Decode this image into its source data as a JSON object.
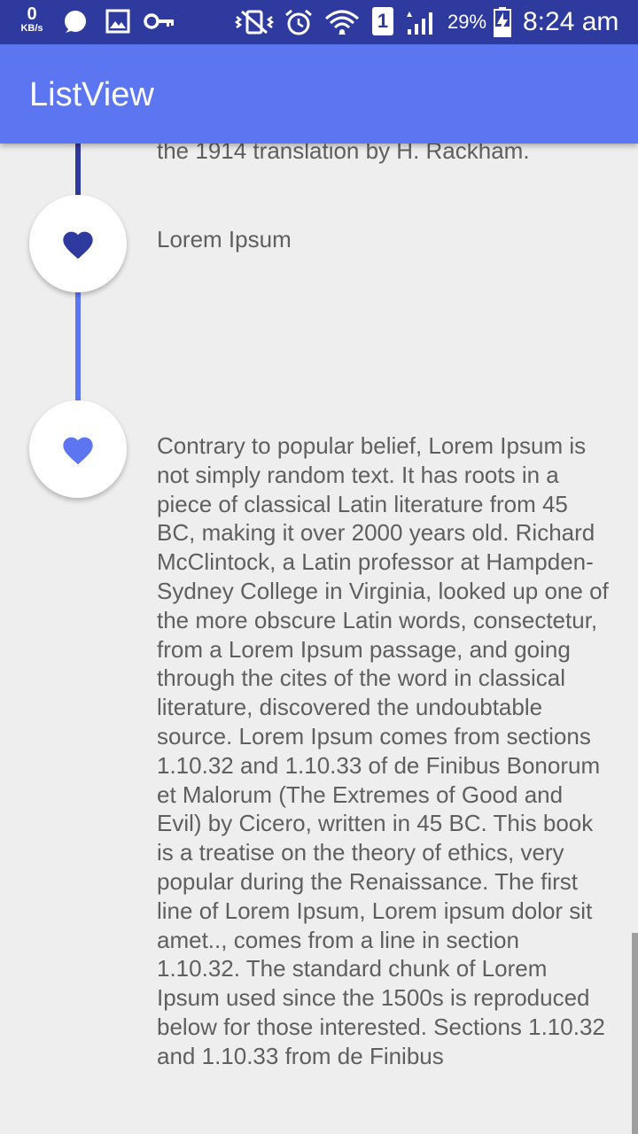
{
  "status_bar": {
    "kb_value": "0",
    "kb_unit": "KB/s",
    "sim_slot": "1",
    "battery_percent": "29%",
    "time": "8:24 am",
    "icons": [
      "chat-bubble-icon",
      "image-icon",
      "key-icon",
      "vibrate-icon",
      "alarm-icon",
      "wifi-icon",
      "sim-icon",
      "signal-icon",
      "battery-charging-icon"
    ]
  },
  "app_bar": {
    "title": "ListView"
  },
  "timeline": {
    "colors": {
      "dark": "#2f3a9e",
      "light": "#5c75f0"
    },
    "items": [
      {
        "icon": "heart-icon",
        "text": "the 1914 translation by H. Rackham."
      },
      {
        "icon": "heart-icon",
        "color": "#2f3a9e",
        "text": "Lorem Ipsum"
      },
      {
        "icon": "heart-icon",
        "color": "#5c75f0",
        "text": "Contrary to popular belief, Lorem Ipsum is not simply random text. It has roots in a piece of classical Latin literature from 45 BC, making it over 2000 years old. Richard McClintock, a Latin professor at Hampden-Sydney College in Virginia, looked up one of the more obscure Latin words, consectetur, from a Lorem Ipsum passage, and going through the cites of the word in classical literature, discovered the undoubtable source. Lorem Ipsum comes from sections 1.10.32 and 1.10.33 of de Finibus Bonorum et Malorum (The Extremes of Good and Evil) by Cicero, written in 45 BC. This book is a treatise on the theory of ethics, very popular during the Renaissance. The first line of Lorem Ipsum, Lorem ipsum dolor sit amet.., comes from a line in section 1.10.32. The standard chunk of Lorem Ipsum used since the 1500s is reproduced below for those interested. Sections 1.10.32 and 1.10.33 from de Finibus"
      }
    ]
  }
}
